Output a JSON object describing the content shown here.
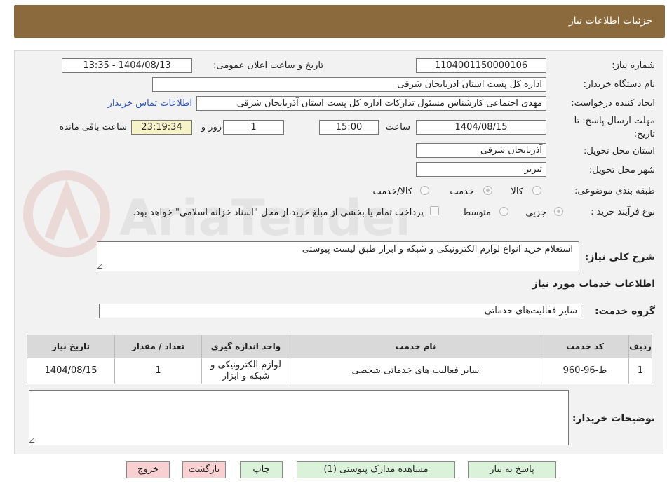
{
  "header": {
    "title": "جزئیات اطلاعات نیاز"
  },
  "watermark": {
    "text": "AriaTender.neT"
  },
  "form": {
    "need_number_label": "شماره نیاز:",
    "need_number_value": "1104001150000106",
    "announce_label": "تاریخ و ساعت اعلان عمومی:",
    "announce_value": "1404/08/13 - 13:35",
    "buyer_org_label": "نام دستگاه خریدار:",
    "buyer_org_value": "اداره کل پست استان آذربایجان شرقی",
    "requester_label": "ایجاد کننده درخواست:",
    "requester_value": "مهدی اجتماعی کارشناس مسئول تدارکات اداره کل پست استان آذربایجان شرقی",
    "contact_link": "اطلاعات تماس خریدار",
    "deadline_label_line1": "مهلت ارسال پاسخ: تا",
    "deadline_label_line2": "تاریخ:",
    "deadline_date": "1404/08/15",
    "time_label": "ساعت",
    "deadline_time": "15:00",
    "days_value": "1",
    "days_label": "روز و",
    "remaining_time": "23:19:34",
    "remaining_label": "ساعت باقی مانده",
    "province_label": "استان محل تحویل:",
    "province_value": "آذربایجان شرقی",
    "city_label": "شهر محل تحویل:",
    "city_value": "تبریز",
    "category_label": "طبقه بندی موضوعی:",
    "category_options": [
      "کالا",
      "خدمت",
      "کالا/خدمت"
    ],
    "process_label": "نوع فرآیند خرید :",
    "process_options": [
      "جزیی",
      "متوسط"
    ],
    "payment_note": "پرداخت تمام یا بخشی از مبلغ خرید،از محل \"اسناد خزانه اسلامی\" خواهد بود."
  },
  "description": {
    "label": "شرح کلی نیاز:",
    "value": "استعلام خرید انواع لوازم الکترونیکی و شبکه و ابزار طبق لیست پیوستی"
  },
  "services": {
    "section_title": "اطلاعات خدمات مورد نیاز",
    "group_label": "گروه خدمت:",
    "group_value": "سایر فعالیت‌های خدماتی",
    "columns": [
      "ردیف",
      "کد خدمت",
      "نام خدمت",
      "واحد اندازه گیری",
      "تعداد / مقدار",
      "تاریخ نیاز"
    ],
    "rows": [
      [
        "1",
        "ط-96-960",
        "سایر فعالیت های خدماتی شخصی",
        "لوازم الکترونیکی و شبکه و ابزار",
        "1",
        "1404/08/15"
      ]
    ]
  },
  "buyer_notes": {
    "label": "توضیحات خریدار:",
    "value": ""
  },
  "buttons": {
    "reply": "پاسخ به نیاز",
    "attachments": "مشاهده مدارک پیوستی (1)",
    "print": "چاپ",
    "back": "بازگشت",
    "exit": "خروج"
  },
  "colors": {
    "header_bg": "#8b6b3e",
    "panel_bg": "#f2f2f2",
    "button_green": "#d9f2d9",
    "button_pink": "#f8d0d2",
    "time_highlight": "#f7f3c9",
    "link": "#2f56c9"
  }
}
